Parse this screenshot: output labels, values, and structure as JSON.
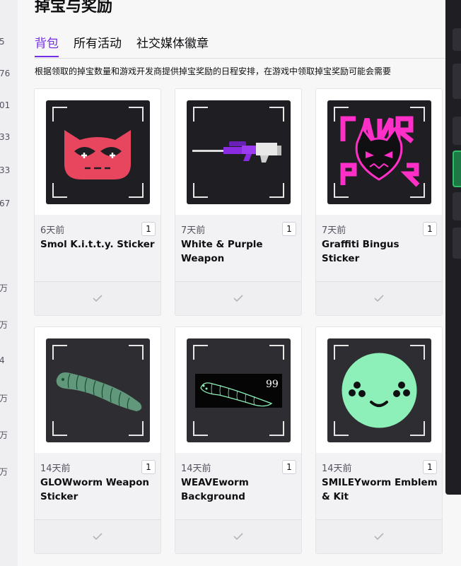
{
  "page": {
    "title": "掉宝与奖励",
    "tabs": [
      {
        "label": "背包",
        "active": true
      },
      {
        "label": "所有活动",
        "active": false
      },
      {
        "label": "社交媒体徽章",
        "active": false
      }
    ],
    "description": "根据领取的掉宝数量和游戏开发商提供掉宝奖励的日程安排，在游戏中领取掉宝奖励可能会需要"
  },
  "left_rail": {
    "numbers": [
      "5",
      "76",
      "01",
      "33",
      "33",
      "67",
      "万",
      "万",
      "4",
      "万",
      "万",
      "万"
    ]
  },
  "colors": {
    "accent": "#772ce8",
    "sticker_red": "#e8455e",
    "graffiti_pink": "#ff2fc8",
    "worm_green": "#8cf0b8",
    "weapon_purple": "#8a2be2"
  },
  "inventory": [
    {
      "age": "6天前",
      "count": "1",
      "title": "Smol K.i.t.t.y. Sticker",
      "icon": "kitty-sticker-icon"
    },
    {
      "age": "7天前",
      "count": "1",
      "title": "White & Purple Weapon",
      "icon": "sniper-rifle-icon"
    },
    {
      "age": "7天前",
      "count": "1",
      "title": "Graffiti Bingus Sticker",
      "icon": "graffiti-cat-icon"
    },
    {
      "age": "14天前",
      "count": "1",
      "title": "GLOWworm Weapon Sticker",
      "icon": "glowworm-icon"
    },
    {
      "age": "14天前",
      "count": "1",
      "title": "WEAVEworm Background",
      "icon": "weaveworm-icon",
      "overlay_number": "99"
    },
    {
      "age": "14天前",
      "count": "1",
      "title": "SMILEYworm Emblem & Kit",
      "icon": "smiley-face-icon"
    }
  ]
}
